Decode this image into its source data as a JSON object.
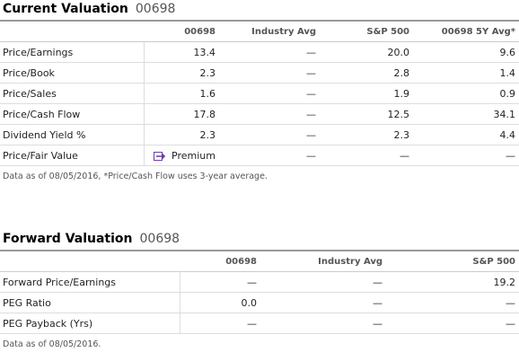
{
  "current": {
    "title": "Current Valuation",
    "ticker": "00698",
    "columns": [
      "00698",
      "Industry Avg",
      "S&P 500",
      "00698 5Y Avg*"
    ],
    "rows": [
      {
        "label": "Price/Earnings",
        "c1": "13.4",
        "c2": "—",
        "c3": "20.0",
        "c4": "9.6"
      },
      {
        "label": "Price/Book",
        "c1": "2.3",
        "c2": "—",
        "c3": "2.8",
        "c4": "1.4"
      },
      {
        "label": "Price/Sales",
        "c1": "1.6",
        "c2": "—",
        "c3": "1.9",
        "c4": "0.9"
      },
      {
        "label": "Price/Cash Flow",
        "c1": "17.8",
        "c2": "—",
        "c3": "12.5",
        "c4": "34.1"
      },
      {
        "label": "Dividend Yield %",
        "c1": "2.3",
        "c2": "—",
        "c3": "2.3",
        "c4": "4.4"
      },
      {
        "label": "Price/Fair Value",
        "c1": "Premium",
        "c2": "—",
        "c3": "—",
        "c4": "—"
      }
    ],
    "premium_icon": "premium-arrow-icon",
    "note": "Data as of 08/05/2016, *Price/Cash Flow uses 3-year average."
  },
  "forward": {
    "title": "Forward Valuation",
    "ticker": "00698",
    "columns": [
      "00698",
      "Industry Avg",
      "S&P 500"
    ],
    "rows": [
      {
        "label": "Forward Price/Earnings",
        "c1": "—",
        "c2": "—",
        "c3": "19.2"
      },
      {
        "label": "PEG Ratio",
        "c1": "0.0",
        "c2": "—",
        "c3": "—"
      },
      {
        "label": "PEG Payback (Yrs)",
        "c1": "—",
        "c2": "—",
        "c3": "—"
      }
    ],
    "note": "Data as of 08/05/2016."
  },
  "colors": {
    "premium_icon": "#6a3fa0",
    "header_rule": "#999999"
  }
}
